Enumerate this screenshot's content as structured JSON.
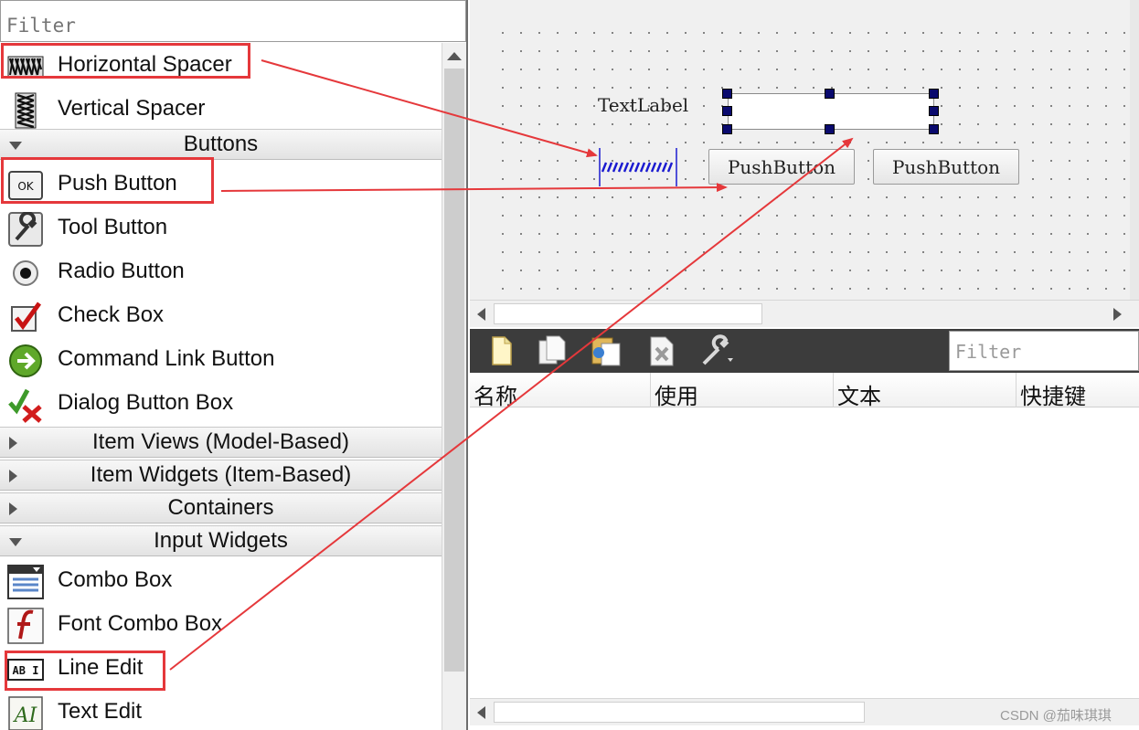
{
  "widget_box": {
    "filter_placeholder": "Filter",
    "items": [
      {
        "label": "Horizontal Spacer",
        "icon": "horizontal-spacer-icon"
      },
      {
        "label": "Vertical Spacer",
        "icon": "vertical-spacer-icon"
      },
      {
        "label": "Push Button",
        "icon": "push-button-icon"
      },
      {
        "label": "Tool Button",
        "icon": "tool-button-icon"
      },
      {
        "label": "Radio Button",
        "icon": "radio-button-icon"
      },
      {
        "label": "Check Box",
        "icon": "check-box-icon"
      },
      {
        "label": "Command Link Button",
        "icon": "command-link-icon"
      },
      {
        "label": "Dialog Button Box",
        "icon": "dialog-button-box-icon"
      },
      {
        "label": "Combo Box",
        "icon": "combo-box-icon"
      },
      {
        "label": "Font Combo Box",
        "icon": "font-combo-box-icon"
      },
      {
        "label": "Line Edit",
        "icon": "line-edit-icon"
      },
      {
        "label": "Text Edit",
        "icon": "text-edit-icon"
      }
    ],
    "categories": [
      {
        "label": "Buttons",
        "expanded": true
      },
      {
        "label": "Item Views (Model-Based)",
        "expanded": false
      },
      {
        "label": "Item Widgets (Item-Based)",
        "expanded": false
      },
      {
        "label": "Containers",
        "expanded": false
      },
      {
        "label": "Input Widgets",
        "expanded": true
      }
    ],
    "push_icon_text": "OK",
    "line_edit_icon_text": "AB I",
    "text_edit_icon_text": "AI"
  },
  "form": {
    "text_label": "TextLabel",
    "push_buttons": [
      "PushButton",
      "PushButton"
    ]
  },
  "action_editor": {
    "filter_placeholder": "Filter",
    "columns": [
      "名称",
      "使用",
      "文本",
      "快捷键"
    ],
    "toolbar_icons": [
      "new-action-icon",
      "copy-action-icon",
      "paste-action-icon",
      "delete-action-icon",
      "configure-icon"
    ]
  },
  "watermark": "CSDN @茄味琪琪",
  "colors": {
    "highlight": "#e5383b",
    "selection_handle": "#0a0a6e",
    "spacer": "#1a1ad0",
    "toolbar": "#3c3c3c"
  }
}
